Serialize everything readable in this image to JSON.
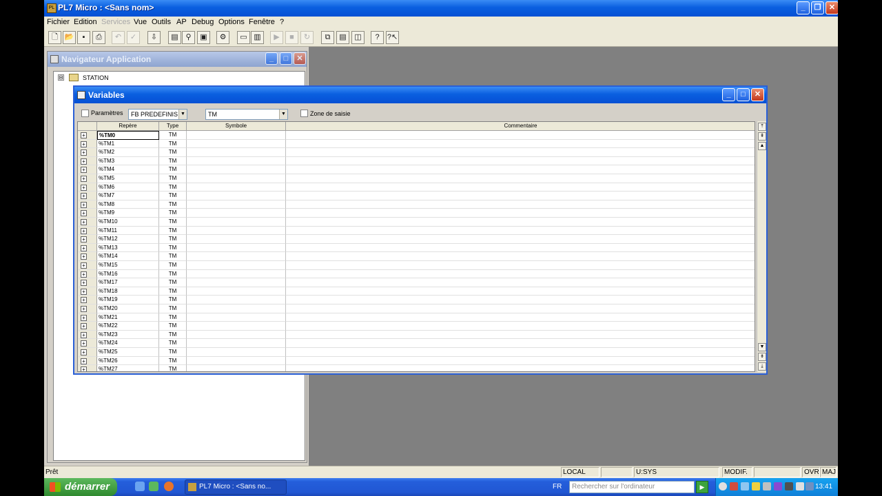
{
  "window": {
    "title": "PL7 Micro : <Sans nom>",
    "app_icon": "app-icon"
  },
  "menu": [
    "Fichier",
    "Edition",
    "Services",
    "Vue",
    "Outils",
    "AP",
    "Debug",
    "Options",
    "Fenêtre",
    "?"
  ],
  "navigator": {
    "title": "Navigateur Application",
    "tree_root": "STATION",
    "expander": "⊟"
  },
  "variables": {
    "title": "Variables",
    "params_label": "Paramètres",
    "category_value": "FB PREDEFINIS",
    "type_value": "TM",
    "zone_label": "Zone de saisie",
    "headers": {
      "repere": "Repère",
      "type": "Type",
      "symbole": "Symbole",
      "commentaire": "Commentaire"
    },
    "rows": [
      {
        "repere": "%TM0",
        "type": "TM"
      },
      {
        "repere": "%TM1",
        "type": "TM"
      },
      {
        "repere": "%TM2",
        "type": "TM"
      },
      {
        "repere": "%TM3",
        "type": "TM"
      },
      {
        "repere": "%TM4",
        "type": "TM"
      },
      {
        "repere": "%TM5",
        "type": "TM"
      },
      {
        "repere": "%TM6",
        "type": "TM"
      },
      {
        "repere": "%TM7",
        "type": "TM"
      },
      {
        "repere": "%TM8",
        "type": "TM"
      },
      {
        "repere": "%TM9",
        "type": "TM"
      },
      {
        "repere": "%TM10",
        "type": "TM"
      },
      {
        "repere": "%TM11",
        "type": "TM"
      },
      {
        "repere": "%TM12",
        "type": "TM"
      },
      {
        "repere": "%TM13",
        "type": "TM"
      },
      {
        "repere": "%TM14",
        "type": "TM"
      },
      {
        "repere": "%TM15",
        "type": "TM"
      },
      {
        "repere": "%TM16",
        "type": "TM"
      },
      {
        "repere": "%TM17",
        "type": "TM"
      },
      {
        "repere": "%TM18",
        "type": "TM"
      },
      {
        "repere": "%TM19",
        "type": "TM"
      },
      {
        "repere": "%TM20",
        "type": "TM"
      },
      {
        "repere": "%TM21",
        "type": "TM"
      },
      {
        "repere": "%TM22",
        "type": "TM"
      },
      {
        "repere": "%TM23",
        "type": "TM"
      },
      {
        "repere": "%TM24",
        "type": "TM"
      },
      {
        "repere": "%TM25",
        "type": "TM"
      },
      {
        "repere": "%TM26",
        "type": "TM"
      },
      {
        "repere": "%TM27",
        "type": "TM"
      }
    ],
    "expander": "+"
  },
  "status": {
    "ready": "Prêt",
    "local": "LOCAL",
    "user": "U:SYS",
    "modif": "MODIF.",
    "ovr": "OVR",
    "maj": "MAJ"
  },
  "taskbar": {
    "start_label": "démarrer",
    "task_label": "PL7 Micro : <Sans no...",
    "lang": "FR",
    "search_placeholder": "Rechercher sur l'ordinateur",
    "go": "▶",
    "clock": "13:41"
  },
  "colors": {
    "title_blue": "#0a5fe0",
    "mdi_gray": "#808080",
    "start_green": "#2f8a2f"
  }
}
